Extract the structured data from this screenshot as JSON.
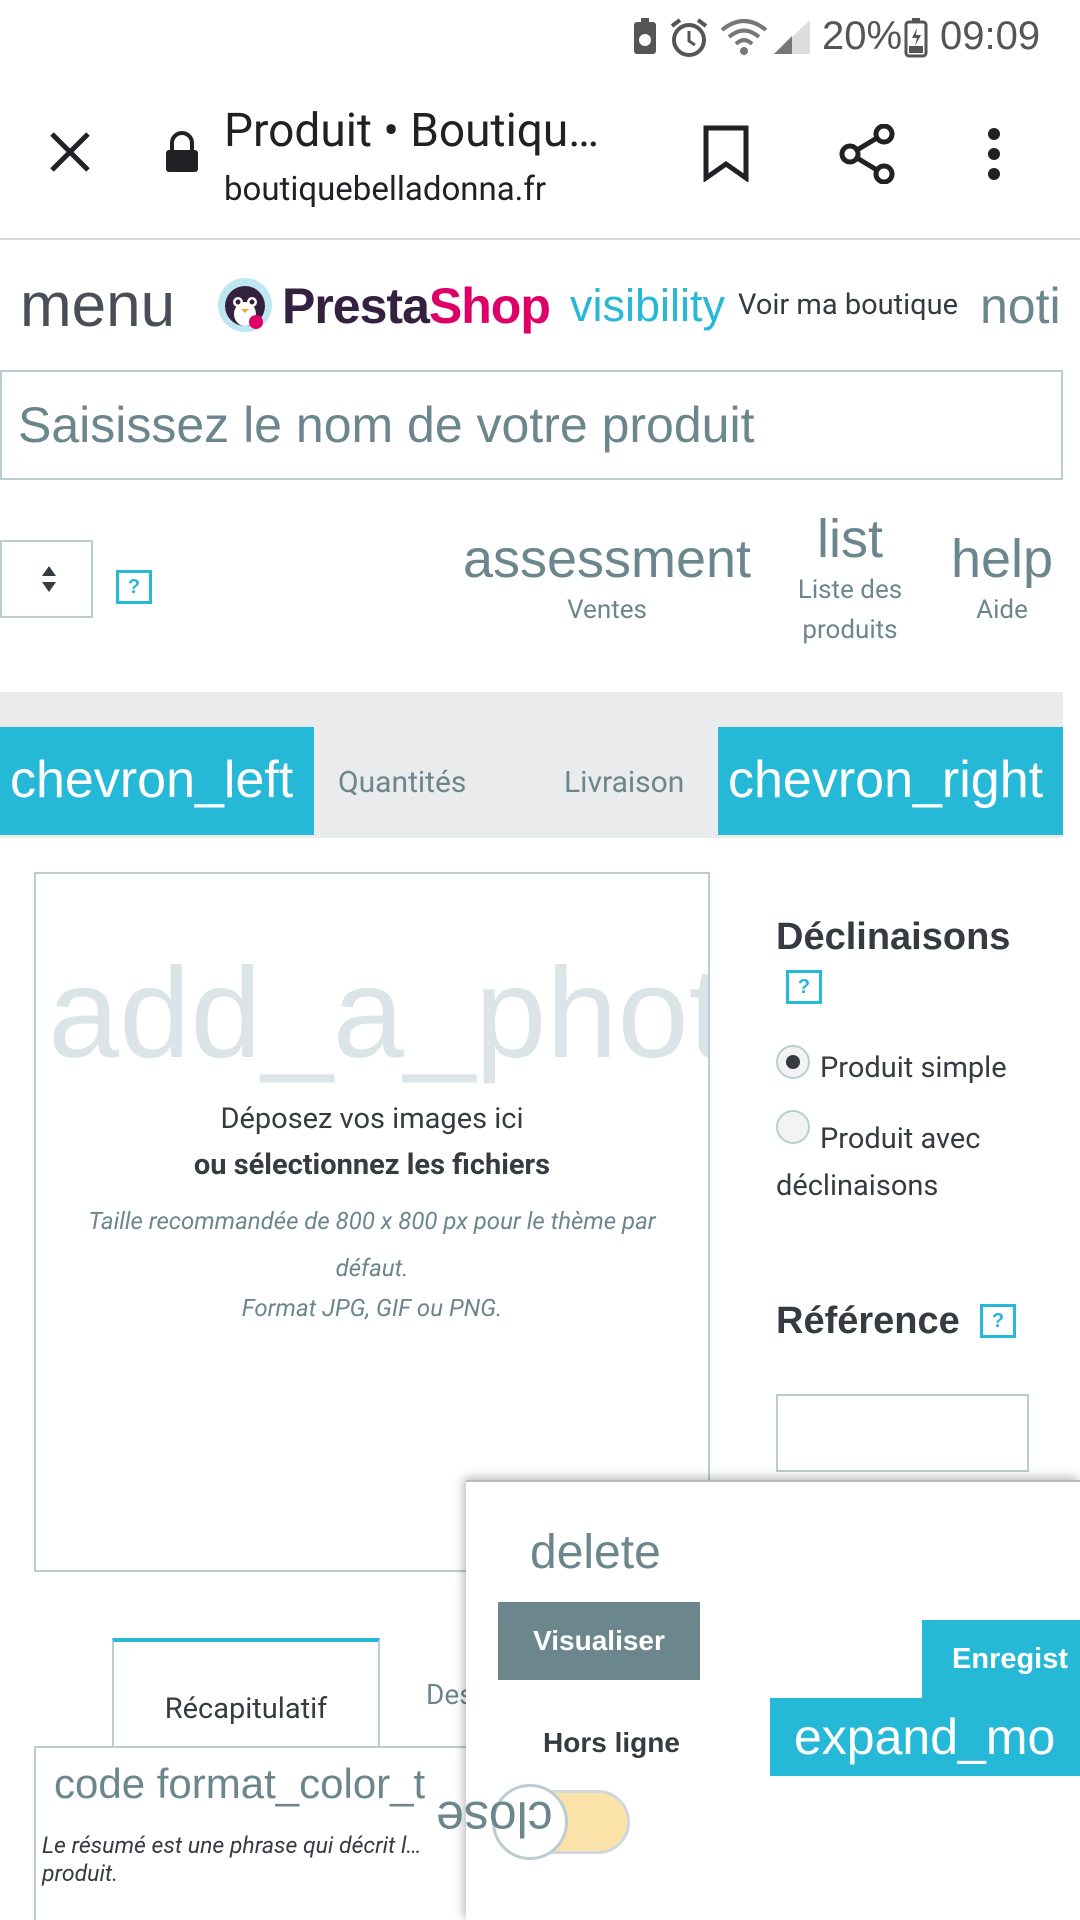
{
  "status_bar": {
    "battery": "20%",
    "time": "09:09",
    "icons": [
      "recycle-battery-icon",
      "alarm-icon",
      "wifi-icon",
      "signal-icon",
      "battery-icon"
    ]
  },
  "browser": {
    "title": "Produit • Boutiqu…",
    "domain": "boutiquebelladonna.fr",
    "icons": [
      "close-icon",
      "lock-icon",
      "bookmark-icon",
      "share-icon",
      "more-vert-icon"
    ]
  },
  "header": {
    "menu": "menu",
    "logo_text_1": "Presta",
    "logo_text_2": "Shop",
    "visibility": "visibility",
    "view_shop": "Voir ma boutique",
    "notifications": "noti"
  },
  "product_name": {
    "placeholder": "Saisissez le nom de votre produit"
  },
  "toolbar": {
    "help_q": "?",
    "items": [
      {
        "icon": "assessment",
        "label": "Ventes"
      },
      {
        "icon": "list",
        "label": "Liste des produits"
      },
      {
        "icon": "help",
        "label": "Aide"
      }
    ]
  },
  "tabs": {
    "prev": "chevron_left",
    "next": "chevron_right",
    "items": [
      "Quantités",
      "Livraison"
    ]
  },
  "dropzone": {
    "icon": "add_a_photo",
    "line1": "Déposez vos images ici",
    "line2": "ou sélectionnez les fichiers",
    "line3": "Taille recommandée de 800 x 800 px pour le thème par défaut.",
    "line4": "Format JPG, GIF ou PNG."
  },
  "declinaisons": {
    "title": "Déclinaisons",
    "help": "?",
    "options": [
      {
        "label": "Produit simple",
        "checked": true
      },
      {
        "label": "Produit avec déclinaisons",
        "checked": false
      }
    ]
  },
  "reference": {
    "title": "Référence",
    "help": "?",
    "value": ""
  },
  "summary_tabs": {
    "active": "Récapitulatif",
    "other": "Des",
    "editor_icons": "code   format_color_t",
    "hint": "Le résumé est une phrase qui décrit l… produit."
  },
  "float_panel": {
    "delete": "delete",
    "preview": "Visualiser",
    "save": "Enregist",
    "expand": "expand_mo",
    "offline": "Hors ligne",
    "close": "close"
  },
  "colors": {
    "accent": "#25b9d7",
    "text_muted": "#6c868e",
    "border": "#bbcdd2",
    "ps_magenta": "#df0067",
    "ps_dark": "#34203f"
  }
}
